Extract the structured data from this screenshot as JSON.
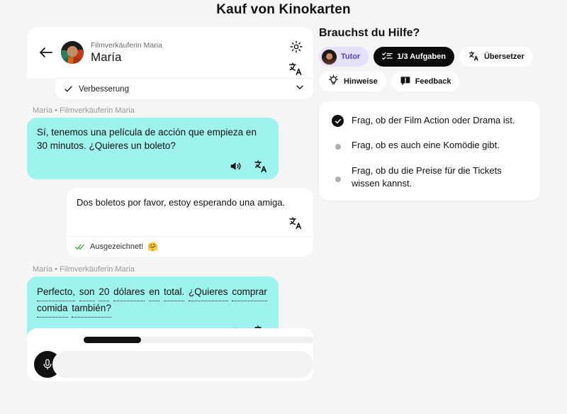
{
  "page": {
    "title": "Kauf von Kinokarten"
  },
  "chat": {
    "header": {
      "back_icon": "back-arrow-icon",
      "subtitle": "Filmverkäuferin Maria",
      "name": "María",
      "gear_icon": "gear-icon",
      "translate_icon": "translate-icon"
    },
    "improvement": {
      "check_icon": "check-icon",
      "label": "Verbesserung",
      "chevron_icon": "chevron-down-icon"
    },
    "messages": [
      {
        "sender_line": "María • Filmverkäuferin Maria",
        "side": "tutor",
        "text": "Sí, tenemos una película de acción que empieza en 30 minutos. ¿Quieres un boleto?",
        "speaker_icon": "speaker-icon",
        "translate_icon": "translate-icon"
      },
      {
        "side": "user",
        "text": "Dos boletos por favor, estoy esperando una amiga.",
        "translate_icon": "translate-icon",
        "feedback": {
          "check_icon": "double-check-icon",
          "label": "Ausgezeichnet!",
          "emoji": "🤗"
        }
      },
      {
        "sender_line": "María • Filmverkäuferin Maria",
        "side": "tutor",
        "annotated_words": [
          "Perfecto,",
          "son",
          "20",
          "dólares",
          "en",
          "total.",
          "¿Quieres",
          "comprar",
          "comida",
          "también?"
        ],
        "text": "Perfecto, son 20 dólares en total. ¿Quieres comprar comida también?",
        "speaker_icon": "speaker-icon",
        "translate_icon": "translate-icon"
      }
    ],
    "composer": {
      "progress_percent": 25,
      "mic_icon": "microphone-icon",
      "input_value": "",
      "input_placeholder": ""
    }
  },
  "help": {
    "title": "Brauchst du Hilfe?",
    "chips": [
      {
        "label": "Tutor",
        "icon": "tutor-avatar-icon",
        "style": "tutor"
      },
      {
        "label": "1/3 Aufgaben",
        "icon": "checklist-icon",
        "style": "dark"
      },
      {
        "label": "Übersetzer",
        "icon": "translate-icon",
        "style": "light"
      },
      {
        "label": "Hinweise",
        "icon": "lightbulb-icon",
        "style": "light"
      },
      {
        "label": "Feedback",
        "icon": "feedback-bubble-icon",
        "style": "light"
      }
    ],
    "tasks": [
      {
        "text": "Frag, ob der Film Action oder Drama ist.",
        "done": true
      },
      {
        "text": "Frag, ob es auch eine Komödie gibt.",
        "done": false
      },
      {
        "text": "Frag, ob du die Preise für die Tickets wissen kannst.",
        "done": false
      }
    ]
  },
  "colors": {
    "tutor_bubble": "#9ff3ee",
    "accent_dark": "#0c0c0c",
    "tutor_chip_bg": "#e5e0fb",
    "tutor_chip_text": "#4f3fc4",
    "page_bg": "#f5f5f5",
    "check_green": "#3aa340"
  }
}
